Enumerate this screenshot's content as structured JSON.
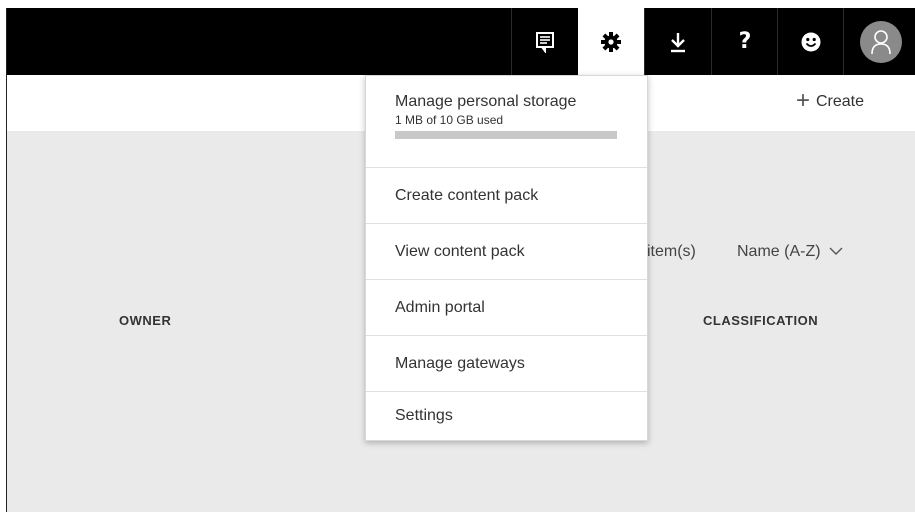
{
  "topbar": {
    "buttons": [
      {
        "name": "feedback",
        "icon": "comment-icon"
      },
      {
        "name": "settings",
        "icon": "gear-icon",
        "active": true
      },
      {
        "name": "download",
        "icon": "download-icon"
      },
      {
        "name": "help",
        "icon": "question-icon",
        "glyph": "?"
      },
      {
        "name": "smiley",
        "icon": "smiley-icon"
      },
      {
        "name": "account",
        "icon": "user-icon"
      }
    ]
  },
  "header": {
    "create_label": "Create",
    "create_icon": "plus-icon"
  },
  "content": {
    "items_count": "item(s)",
    "sort_label": "Name (A-Z)",
    "columns": {
      "owner": "OWNER",
      "classification": "CLASSIFICATION"
    }
  },
  "settings_menu": {
    "storage": {
      "title": "Manage personal storage",
      "usage": "1 MB of 10 GB used",
      "used_fraction": 0.0001
    },
    "items": [
      "Create content pack",
      "View content pack",
      "Admin portal",
      "Manage gateways",
      "Settings"
    ]
  },
  "colors": {
    "topbar_bg": "#000000",
    "content_bg": "#eaeaea",
    "active_tab_bg": "#ffffff",
    "avatar_bg": "#8a8a8a"
  }
}
